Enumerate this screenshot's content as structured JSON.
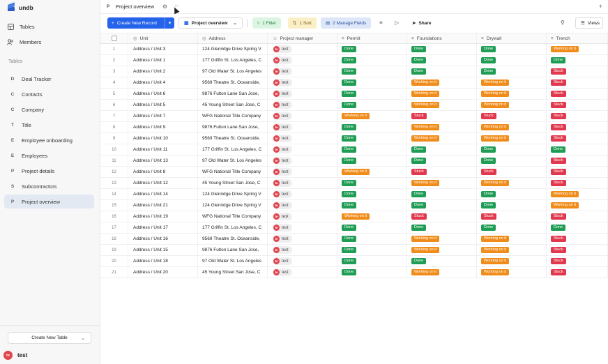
{
  "app": {
    "name": "undb"
  },
  "sidebar": {
    "nav": [
      {
        "label": "Tables",
        "icon": "table-icon"
      },
      {
        "label": "Members",
        "icon": "users-icon"
      }
    ],
    "section_label": "Tables",
    "tables": [
      {
        "letter": "D",
        "label": "Deal Tracker"
      },
      {
        "letter": "C",
        "label": "Contacts"
      },
      {
        "letter": "C",
        "label": "Company"
      },
      {
        "letter": "T",
        "label": "Title"
      },
      {
        "letter": "E",
        "label": "Employee onboarding"
      },
      {
        "letter": "E",
        "label": "Employees"
      },
      {
        "letter": "P",
        "label": "Project details"
      },
      {
        "letter": "S",
        "label": "Subcontractors"
      },
      {
        "letter": "P",
        "label": "Project overview",
        "active": true
      }
    ],
    "create_table_label": "Create New Table",
    "user": {
      "initials": "te",
      "name": "test"
    }
  },
  "topbar": {
    "letter": "P",
    "title": "Project overview"
  },
  "toolbar": {
    "create_label": "Create New Record",
    "view_label": "Project overview",
    "filter_label": "1 Filter",
    "sort_label": "1 Sort",
    "fields_label": "2 Manage Fields",
    "share_label": "Share",
    "views_label": "Views"
  },
  "columns": [
    "Unit",
    "Address",
    "Project manager",
    "Permit",
    "Foundations",
    "Drywall",
    "Trench"
  ],
  "status_labels": {
    "done": "Done",
    "working": "Working on it",
    "stuck": "Stuck"
  },
  "colors": {
    "done": "#1f9d55",
    "working": "#f08c1a",
    "stuck": "#e2384d",
    "primary": "#2563eb"
  },
  "rows": [
    {
      "id": "1",
      "unit": "Address / Unit 3",
      "address": "124 Glenridge Drive Spring V",
      "pm": "test",
      "permit": "Done",
      "foundations": "Done",
      "drywall": "Done",
      "trench": "Working on it"
    },
    {
      "id": "2",
      "unit": "Address / Unit 1",
      "address": "177 Griffin St. Los Angeles, C",
      "pm": "test",
      "permit": "Done",
      "foundations": "Done",
      "drywall": "Done",
      "trench": "Done"
    },
    {
      "id": "3",
      "unit": "Address / Unit 2",
      "address": "97 Old Water St. Los Angeles",
      "pm": "test",
      "permit": "Done",
      "foundations": "Done",
      "drywall": "Done",
      "trench": "Stuck"
    },
    {
      "id": "4",
      "unit": "Address / Unit 4",
      "address": "9569 Theatre St. Oceanside,",
      "pm": "test",
      "permit": "Done",
      "foundations": "Working on it",
      "drywall": "Working on it",
      "trench": "Stuck"
    },
    {
      "id": "5",
      "unit": "Address / Unit 6",
      "address": "9876 Fulton Lane San Jose,",
      "pm": "test",
      "permit": "Done",
      "foundations": "Working on it",
      "drywall": "Working on it",
      "trench": "Stuck"
    },
    {
      "id": "6",
      "unit": "Address / Unit 5",
      "address": "45 Young Street San Jose, C",
      "pm": "test",
      "permit": "Done",
      "foundations": "Working on it",
      "drywall": "Working on it",
      "trench": "Stuck"
    },
    {
      "id": "7",
      "unit": "Address / Unit 7",
      "address": "WFG National Title Company",
      "pm": "test",
      "permit": "Working on it",
      "foundations": "Stuck",
      "drywall": "Stuck",
      "trench": "Stuck"
    },
    {
      "id": "8",
      "unit": "Address / Unit 9",
      "address": "9876 Fulton Lane San Jose,",
      "pm": "test",
      "permit": "Done",
      "foundations": "Working on it",
      "drywall": "Working on it",
      "trench": "Stuck"
    },
    {
      "id": "9",
      "unit": "Address / Unit 10",
      "address": "9569 Theatre St. Oceanside,",
      "pm": "test",
      "permit": "Done",
      "foundations": "Working on it",
      "drywall": "Working on it",
      "trench": "Stuck"
    },
    {
      "id": "10",
      "unit": "Address / Unit 11",
      "address": "177 Griffin St. Los Angeles, C",
      "pm": "test",
      "permit": "Done",
      "foundations": "Done",
      "drywall": "Done",
      "trench": "Done"
    },
    {
      "id": "11",
      "unit": "Address / Unit 13",
      "address": "97 Old Water St. Los Angeles",
      "pm": "test",
      "permit": "Done",
      "foundations": "Done",
      "drywall": "Done",
      "trench": "Stuck"
    },
    {
      "id": "12",
      "unit": "Address / Unit 8",
      "address": "WFG National Title Company",
      "pm": "test",
      "permit": "Working on it",
      "foundations": "Stuck",
      "drywall": "Stuck",
      "trench": "Stuck"
    },
    {
      "id": "13",
      "unit": "Address / Unit 12",
      "address": "45 Young Street San Jose, C",
      "pm": "test",
      "permit": "Done",
      "foundations": "Working on it",
      "drywall": "Working on it",
      "trench": "Stuck"
    },
    {
      "id": "14",
      "unit": "Address / Unit 14",
      "address": "124 Glenridge Drive Spring V",
      "pm": "test",
      "permit": "Done",
      "foundations": "Done",
      "drywall": "Done",
      "trench": "Working on it"
    },
    {
      "id": "15",
      "unit": "Address / Unit 21",
      "address": "124 Glenridge Drive Spring V",
      "pm": "test",
      "permit": "Done",
      "foundations": "Done",
      "drywall": "Done",
      "trench": "Working on it"
    },
    {
      "id": "16",
      "unit": "Address / Unit 19",
      "address": "WFG National Title Company",
      "pm": "test",
      "permit": "Working on it",
      "foundations": "Stuck",
      "drywall": "Stuck",
      "trench": "Stuck"
    },
    {
      "id": "17",
      "unit": "Address / Unit 17",
      "address": "177 Griffin St. Los Angeles, C",
      "pm": "test",
      "permit": "Done",
      "foundations": "Done",
      "drywall": "Done",
      "trench": "Done"
    },
    {
      "id": "18",
      "unit": "Address / Unit 16",
      "address": "9569 Theatre St. Oceanside,",
      "pm": "test",
      "permit": "Done",
      "foundations": "Working on it",
      "drywall": "Working on it",
      "trench": "Stuck"
    },
    {
      "id": "19",
      "unit": "Address / Unit 15",
      "address": "9876 Fulton Lane San Jose,",
      "pm": "test",
      "permit": "Done",
      "foundations": "Working on it",
      "drywall": "Working on it",
      "trench": "Stuck"
    },
    {
      "id": "20",
      "unit": "Address / Unit 18",
      "address": "97 Old Water St. Los Angeles",
      "pm": "test",
      "permit": "Done",
      "foundations": "Done",
      "drywall": "Working on it",
      "trench": "Stuck"
    },
    {
      "id": "21",
      "unit": "Address / Unit 20",
      "address": "45 Young Street San Jose, C",
      "pm": "test",
      "permit": "Done",
      "foundations": "Working on it",
      "drywall": "Working on it",
      "trench": "Stuck"
    }
  ]
}
